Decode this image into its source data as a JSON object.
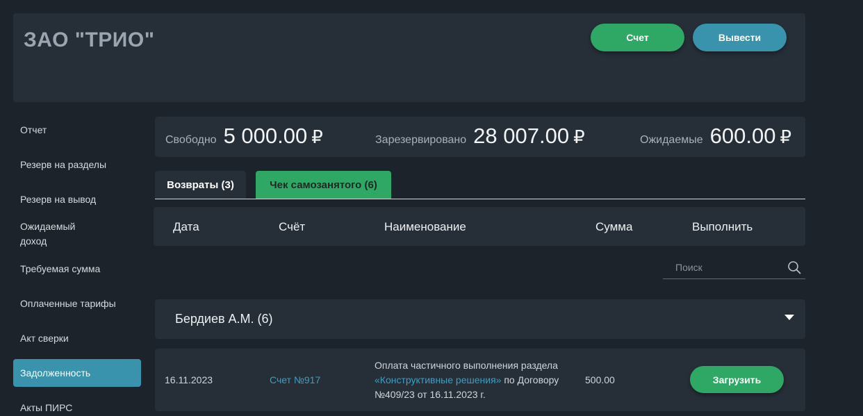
{
  "header": {
    "company": "ЗАО \"ТРИО\"",
    "invoice_button": "Счет",
    "withdraw_button": "Вывести"
  },
  "sidebar": {
    "items": [
      {
        "label": "Отчет"
      },
      {
        "label": "Резерв на разделы"
      },
      {
        "label": "Резерв на вывод"
      },
      {
        "label_line1": "Ожидаемый",
        "label_line2": "доход"
      },
      {
        "label": "Требуемая сумма"
      },
      {
        "label": "Оплаченные тарифы"
      },
      {
        "label": "Акт сверки"
      },
      {
        "label": "Задолженность",
        "active": true
      },
      {
        "label": "Акты ПИРС"
      }
    ]
  },
  "balances": {
    "free": {
      "label": "Свободно",
      "value": "5 000.00",
      "currency": "₽"
    },
    "reserved": {
      "label": "Зарезервировано",
      "value": "28 007.00",
      "currency": "₽"
    },
    "expected": {
      "label": "Ожидаемые",
      "value": "600.00",
      "currency": "₽"
    }
  },
  "tabs": [
    {
      "label": "Возвраты (3)",
      "active": false
    },
    {
      "label": "Чек самозанятого (6)",
      "active": true
    }
  ],
  "table": {
    "columns": [
      "Дата",
      "Счёт",
      "Наименование",
      "Сумма",
      "Выполнить"
    ]
  },
  "search": {
    "placeholder": "Поиск"
  },
  "group": {
    "title": "Бердиев А.М. (6)"
  },
  "rows": [
    {
      "date": "16.11.2023",
      "invoice": "Счет №917",
      "desc_prefix": "Оплата частичного выполнения раздела",
      "desc_link": "«Конструктивные решения»",
      "desc_middle": "по Договору",
      "desc_suffix": "№409/23 от 16.11.2023 г.",
      "amount": "500.00",
      "action": "Загрузить"
    }
  ],
  "colors": {
    "background": "#1c232b",
    "panel": "#262e38",
    "green": "#2fa866",
    "blue": "#3a93ac",
    "link": "#3aa0c4"
  }
}
